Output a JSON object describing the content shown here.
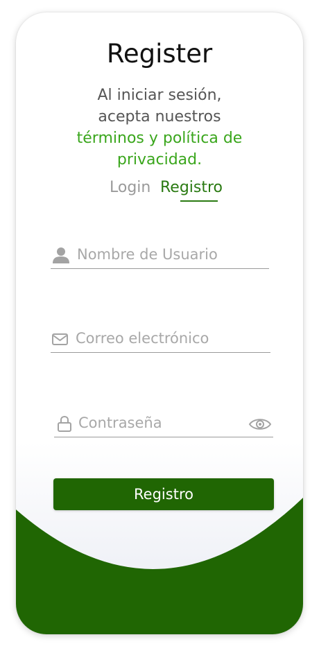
{
  "screen": {
    "title": "Register",
    "subtitle_line1": "Al iniciar sesión,",
    "subtitle_line2": "acepta nuestros",
    "terms_link_line1": "términos y política de",
    "terms_link_line2": "privacidad."
  },
  "tabs": {
    "login_label": "Login",
    "register_label": "Registro",
    "active": "Registro"
  },
  "form": {
    "username": {
      "value": "",
      "placeholder": "Nombre de Usuario",
      "icon": "user-icon"
    },
    "email": {
      "value": "",
      "placeholder": "Correo electrónico",
      "icon": "mail-icon"
    },
    "password": {
      "value": "",
      "placeholder": "Contraseña",
      "icon": "lock-icon",
      "toggle_icon": "eye-icon"
    },
    "submit_label": "Registro"
  },
  "colors": {
    "accent_green": "#206603",
    "link_green": "#3aa61c",
    "active_tab_green": "#2a7a12"
  }
}
